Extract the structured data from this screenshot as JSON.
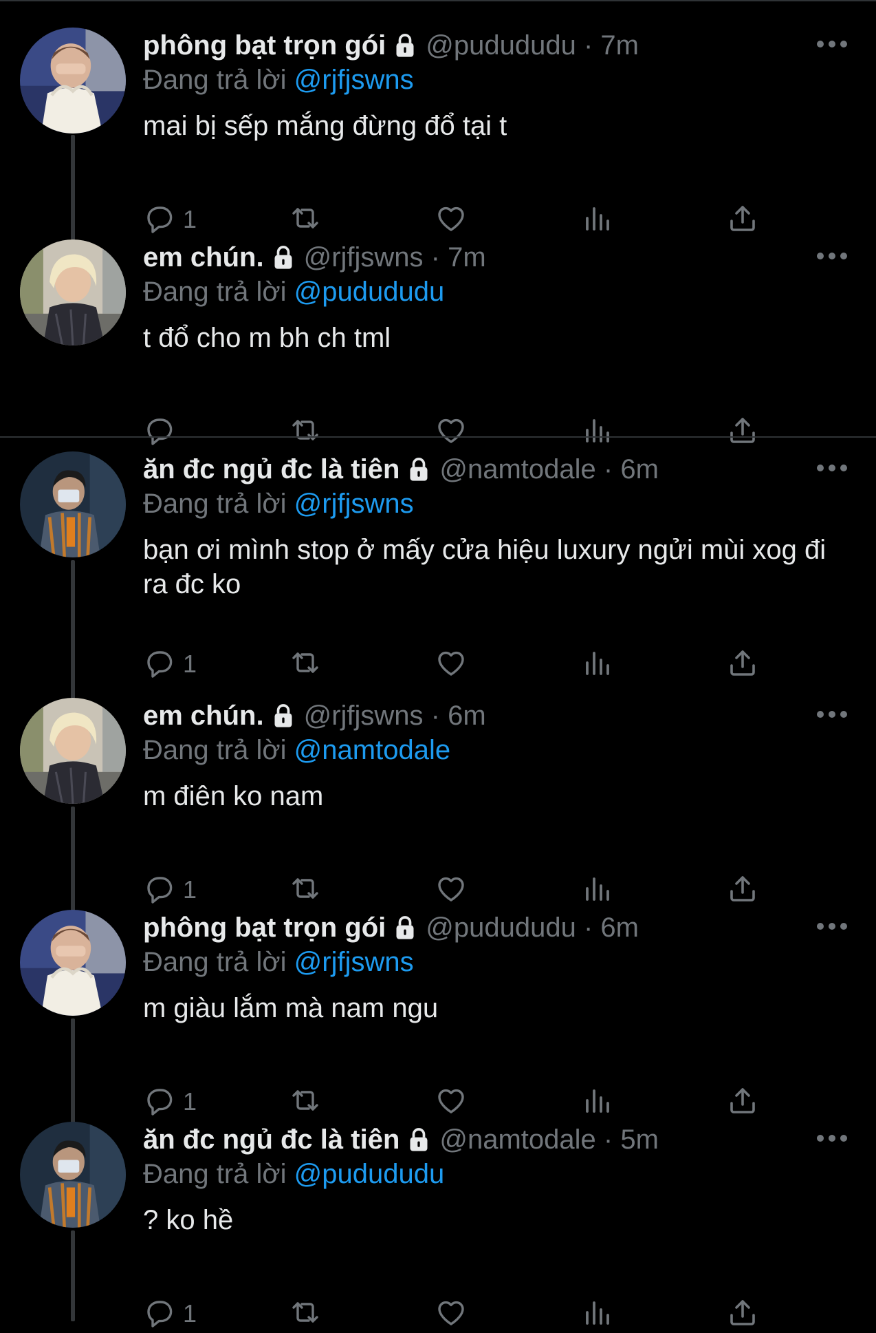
{
  "colors": {
    "background": "#000000",
    "text_primary": "#e7e9ea",
    "text_secondary": "#71767b",
    "mention": "#1d9bf0",
    "divider": "#2f3336"
  },
  "replying_prefix": "Đang trả lời",
  "tweets": [
    {
      "display_name": "phông bạt trọn gói",
      "handle_time": "@pudududu · 7m",
      "reply_to": "@rjfjswns",
      "text": "mai bị sếp mắng đừng đổ tại t",
      "reply_count": "1",
      "avatar_icon": "avatar-pudududu",
      "lock_icon": "lock-icon"
    },
    {
      "display_name": "em chún.",
      "handle_time": "@rjfjswns · 7m",
      "reply_to": "@pudududu",
      "text": "t đổ cho m bh ch tml",
      "reply_count": "",
      "avatar_icon": "avatar-rjfjswns",
      "lock_icon": "lock-icon"
    },
    {
      "display_name": "ăn đc ngủ đc là tiên",
      "handle_time": "@namtodale · 6m",
      "reply_to": "@rjfjswns",
      "text": "bạn ơi mình stop ở mấy cửa hiệu luxury ngửi mùi xog đi ra đc ko",
      "reply_count": "1",
      "avatar_icon": "avatar-namtodale",
      "lock_icon": "lock-icon"
    },
    {
      "display_name": "em chún.",
      "handle_time": "@rjfjswns · 6m",
      "reply_to": "@namtodale",
      "text": "m điên ko nam",
      "reply_count": "1",
      "avatar_icon": "avatar-rjfjswns",
      "lock_icon": "lock-icon"
    },
    {
      "display_name": "phông bạt trọn gói",
      "handle_time": "@pudududu · 6m",
      "reply_to": "@rjfjswns",
      "text": "m giàu lắm mà nam ngu",
      "reply_count": "1",
      "avatar_icon": "avatar-pudududu",
      "lock_icon": "lock-icon"
    },
    {
      "display_name": "ăn đc ngủ đc là tiên",
      "handle_time": "@namtodale · 5m",
      "reply_to": "@pudududu",
      "text": "? ko hề",
      "reply_count": "1",
      "avatar_icon": "avatar-namtodale",
      "lock_icon": "lock-icon"
    }
  ]
}
